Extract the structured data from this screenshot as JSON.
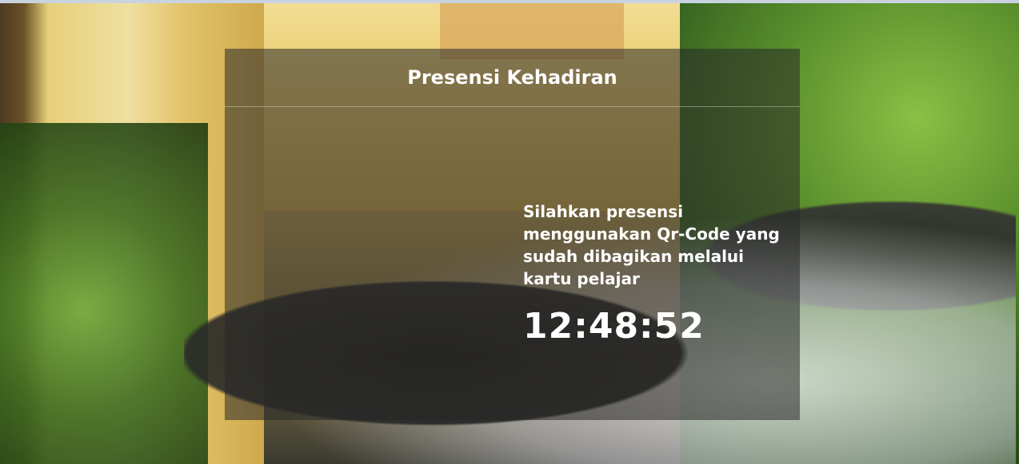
{
  "panel": {
    "title": "Presensi Kehadiran",
    "instruction": "Silahkan presensi menggunakan Qr-Code yang sudah dibagikan melalui kartu pelajar",
    "clock": "12:48:52"
  },
  "colors": {
    "panel_overlay": "rgba(40,40,40,0.55)",
    "text": "#ffffff"
  }
}
